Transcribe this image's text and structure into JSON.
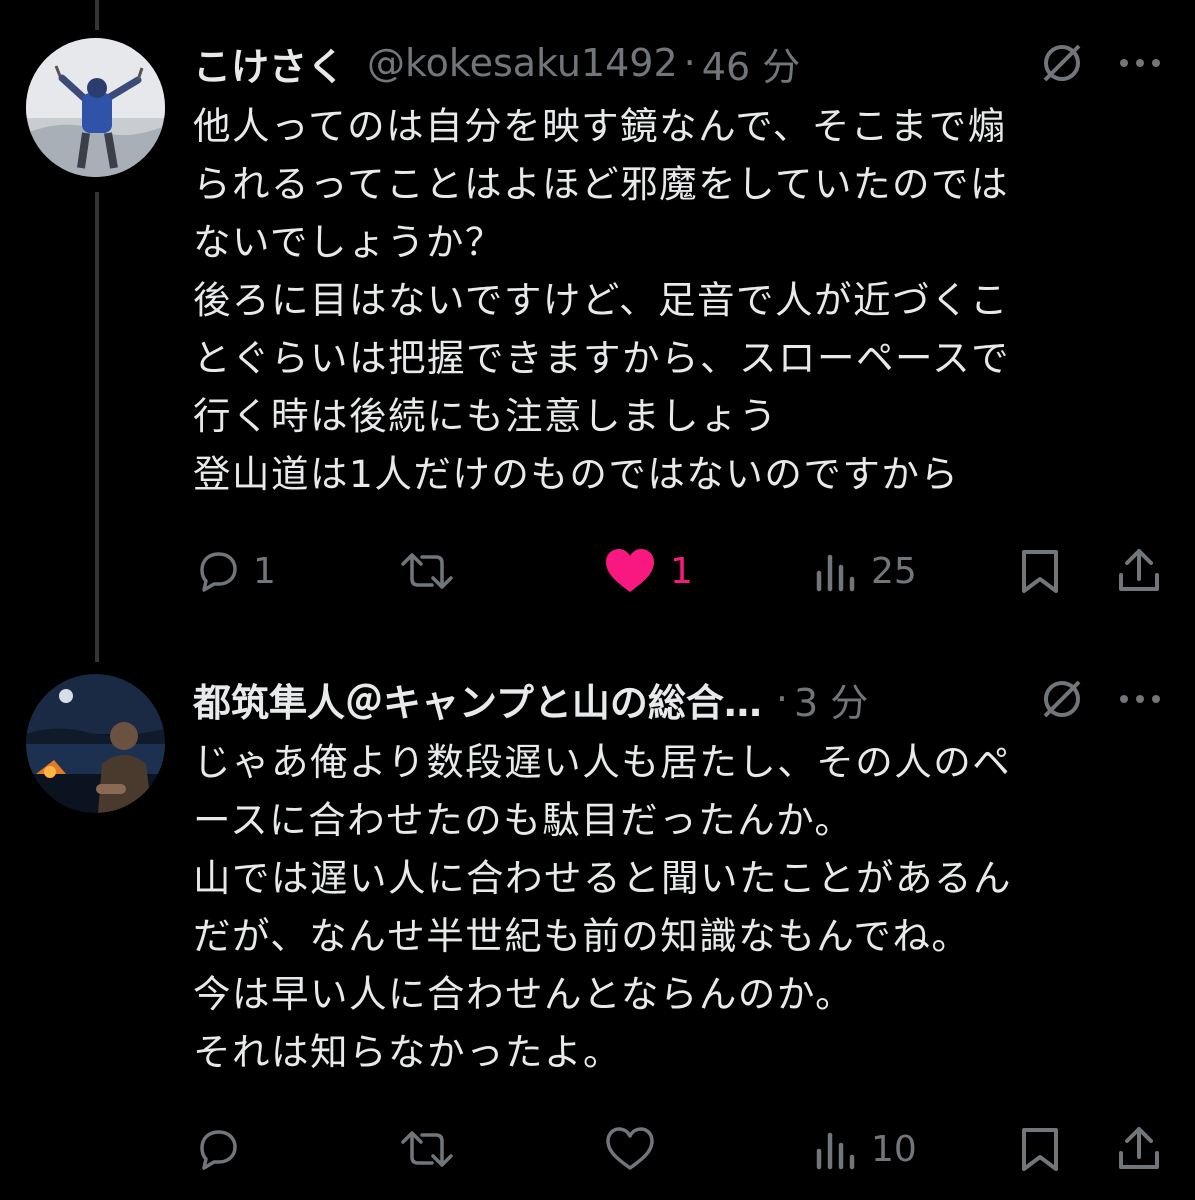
{
  "tweets": [
    {
      "name": "こけさく",
      "handle": "@kokesaku1492",
      "separator": "·",
      "time": "46 分",
      "lines": [
        "他人ってのは自分を映す鏡なんで、そこまで煽",
        "られるってことはよほど邪魔をしていたのでは",
        "ないでしょうか？",
        "後ろに目はないですけど、足音で人が近づくこ",
        "とぐらいは把握できますから、スローペースで",
        "行く時は後続にも注意しましょう",
        "登山道は1人だけのものではないのですから"
      ],
      "replies": "1",
      "retweets": "",
      "likes": "1",
      "views": "25",
      "liked": true
    },
    {
      "name": "都筑隼人＠キャンプと山の総合…",
      "handle": "",
      "separator": "·",
      "time": "3 分",
      "lines": [
        "じゃあ俺より数段遅い人も居たし、その人のペ",
        "ースに合わせたのも駄目だったんか。",
        "山では遅い人に合わせると聞いたことがあるん",
        "だが、なんせ半世紀も前の知識なもんでね。",
        "今は早い人に合わせんとならんのか。",
        "それは知らなかったよ。"
      ],
      "replies": "",
      "retweets": "",
      "likes": "",
      "views": "10",
      "liked": false
    }
  ],
  "colors": {
    "background": "#000000",
    "text": "#e7e9ea",
    "muted": "#71767b",
    "like": "#f91880",
    "thread_line": "#333639"
  },
  "icons": [
    "grok-icon",
    "more-icon",
    "reply-icon",
    "retweet-icon",
    "heart-icon",
    "views-icon",
    "bookmark-icon",
    "share-icon"
  ]
}
